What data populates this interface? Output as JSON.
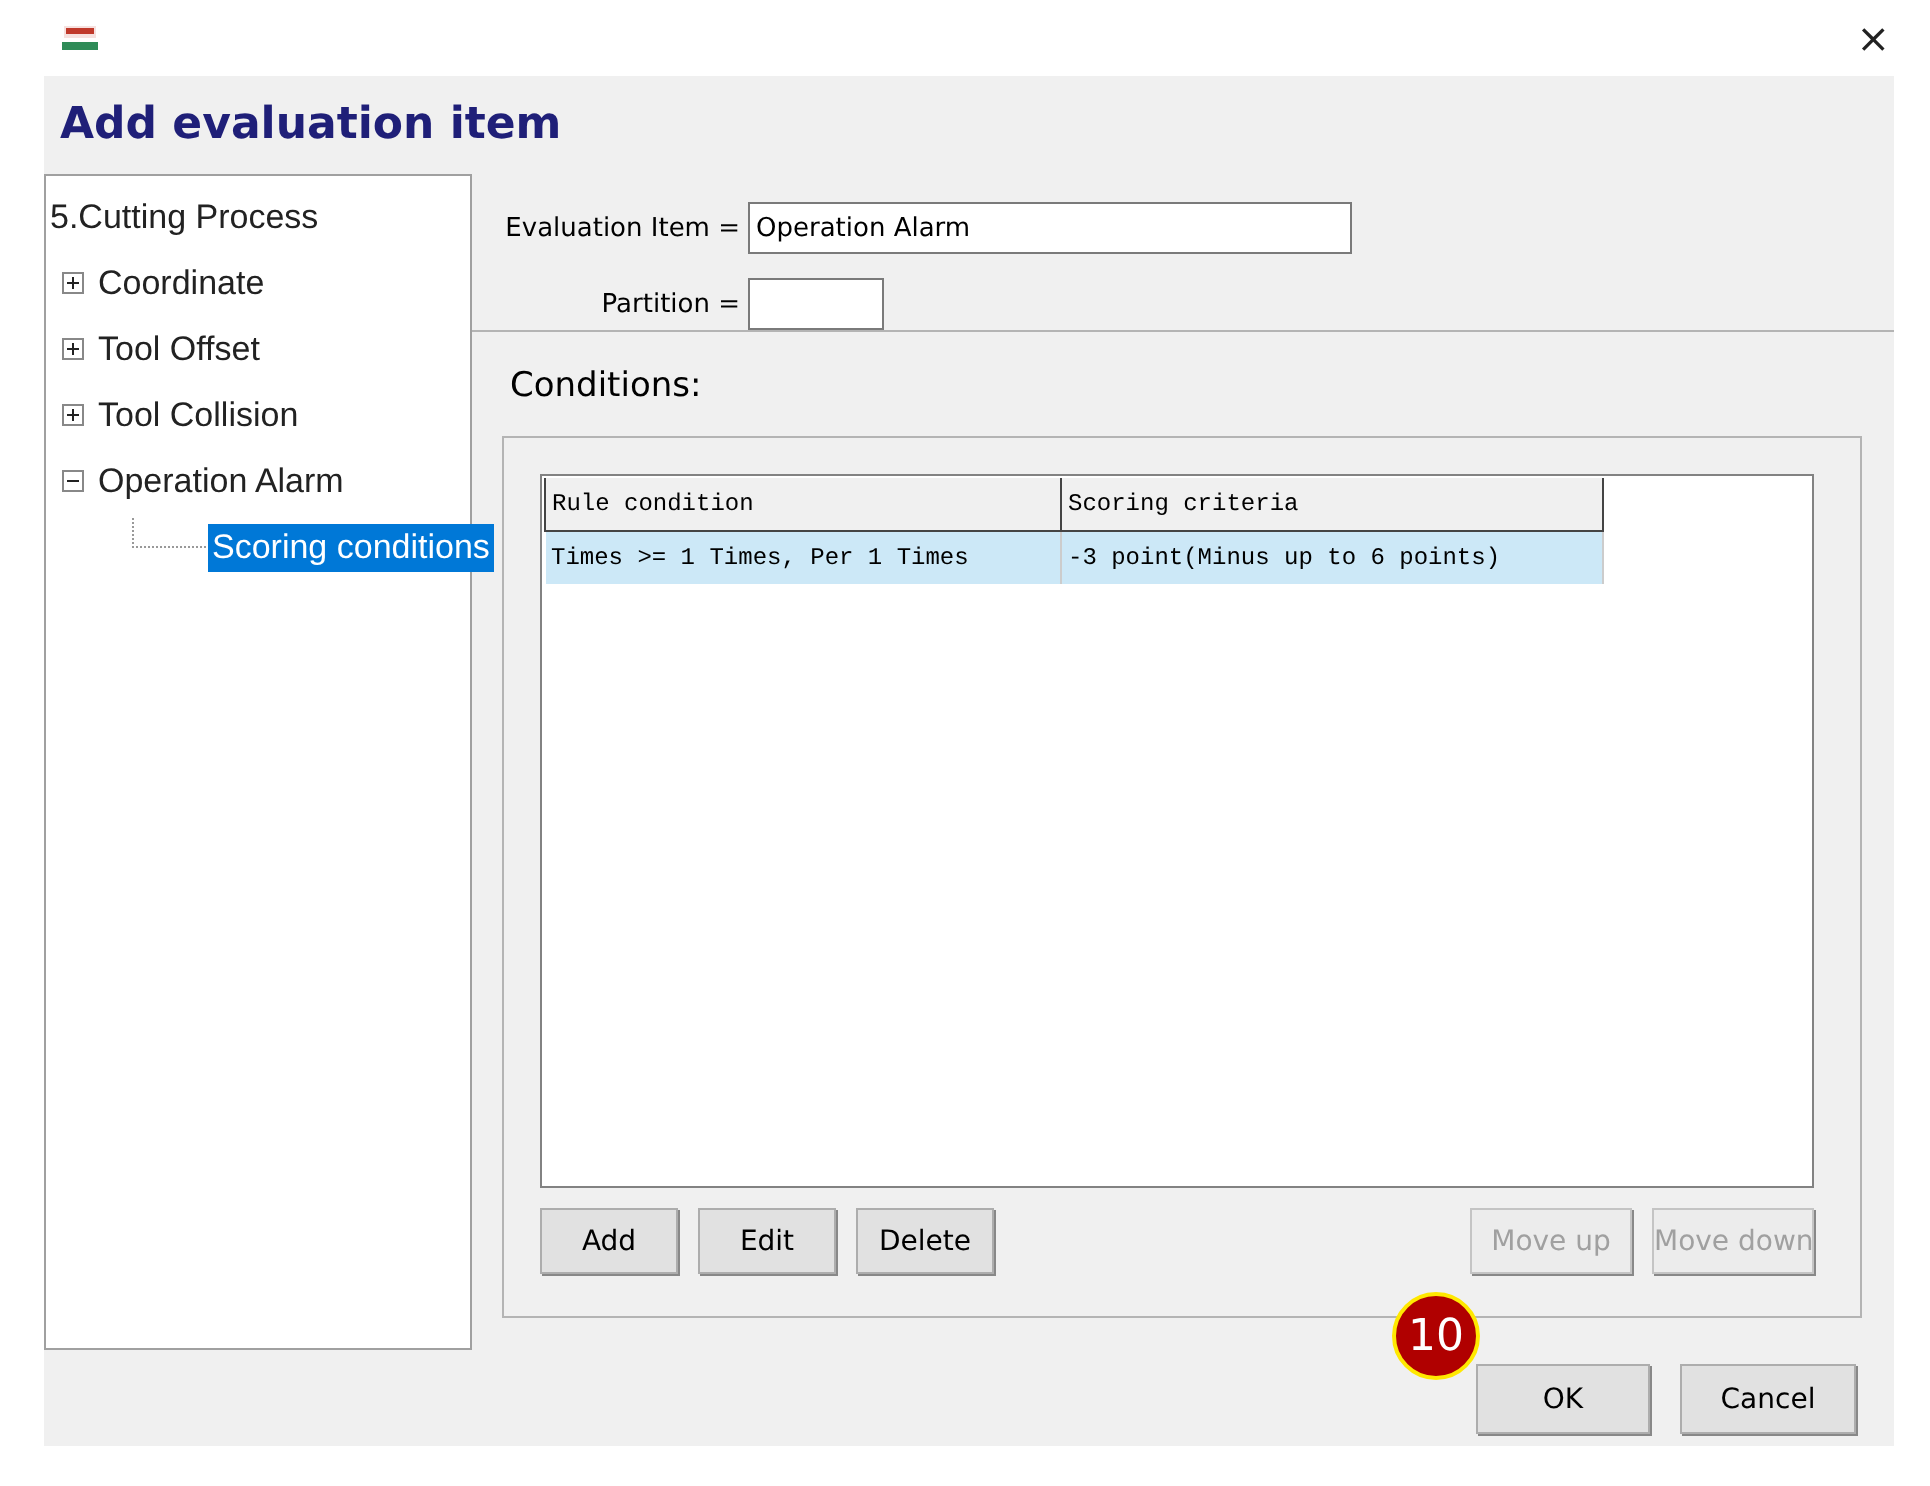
{
  "window": {
    "close_glyph": "×"
  },
  "dialog": {
    "title": "Add evaluation item"
  },
  "tree": {
    "root": "5.Cutting Process",
    "items": [
      {
        "label": "Coordinate",
        "expanded": false,
        "selected": false
      },
      {
        "label": "Tool Offset",
        "expanded": false,
        "selected": false
      },
      {
        "label": "Tool Collision",
        "expanded": false,
        "selected": false
      },
      {
        "label": "Operation Alarm",
        "expanded": true,
        "selected": false,
        "children": [
          {
            "label": "Scoring conditions",
            "selected": true
          }
        ]
      }
    ]
  },
  "fields": [
    {
      "label": "Evaluation Item =",
      "value": "Operation Alarm",
      "wide": true
    },
    {
      "label": "Partition =",
      "wide": false
    }
  ],
  "conditions": {
    "label": "Conditions:",
    "columns": [
      "Rule condition",
      "Scoring criteria"
    ],
    "rows": [
      {
        "cells": [
          "Times >= 1 Times, Per 1 Times",
          "-3 point(Minus up to 6 points)"
        ],
        "selected": true
      }
    ],
    "buttons": [
      {
        "label": "Add",
        "disabled": false
      },
      {
        "label": "Edit",
        "disabled": false
      },
      {
        "label": "Delete",
        "disabled": false
      },
      {
        "label": "Move up",
        "disabled": true
      },
      {
        "label": "Move down",
        "disabled": true
      }
    ]
  },
  "footer_buttons": [
    "OK",
    "Cancel"
  ],
  "callout": {
    "label": "10"
  }
}
